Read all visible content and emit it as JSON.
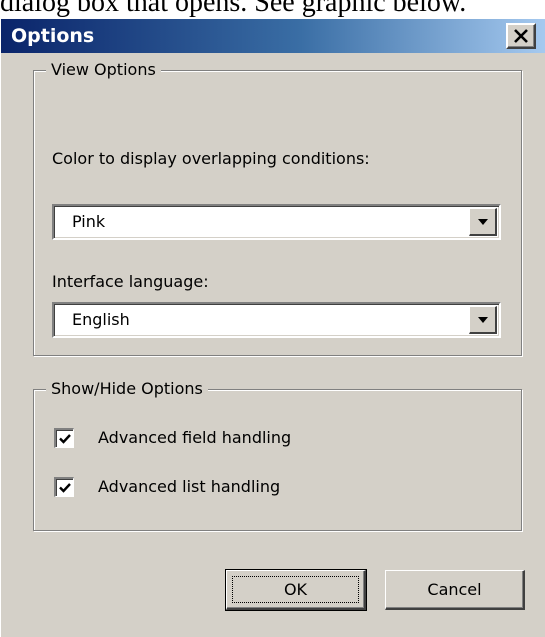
{
  "document": {
    "caption": "dialog box that opens. See graphic below."
  },
  "dialog": {
    "title": "Options",
    "close_glyph": "×",
    "view_options": {
      "legend": "View Options",
      "color_label": "Color to display overlapping conditions:",
      "color_value": "Pink",
      "language_label": "Interface language:",
      "language_value": "English"
    },
    "show_hide_options": {
      "legend": "Show/Hide Options",
      "items": [
        {
          "label": "Advanced field handling",
          "checked": true
        },
        {
          "label": "Advanced list handling",
          "checked": true
        }
      ]
    },
    "buttons": {
      "ok": "OK",
      "cancel": "Cancel"
    }
  },
  "colors": {
    "face": "#d4d0c8",
    "title_start": "#0a246a",
    "title_end": "#a6caf0"
  }
}
